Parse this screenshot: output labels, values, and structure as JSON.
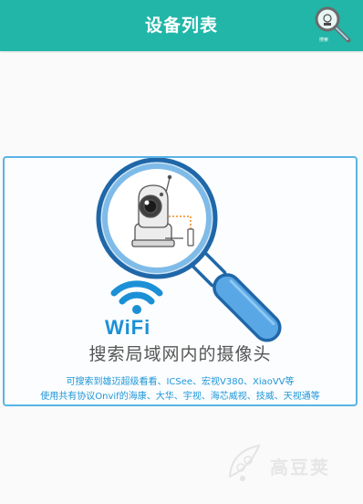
{
  "header": {
    "title": "设备列表",
    "search_caption": "搜索"
  },
  "card": {
    "wifi_label": "WiFi",
    "main_text": "搜索局域网内的摄像头",
    "sub_line1": "可搜索到雄迈超级看看、ICSee、宏视V380、XiaoVV等",
    "sub_line2": "使用共有协议Onvif的海康、大华、宇视、海芯威视、技威、天视通等"
  },
  "watermark": {
    "text": "高豆荚"
  },
  "colors": {
    "header_bg": "#21b6a8",
    "card_border": "#5ab4e6",
    "accent_blue": "#1e96d8",
    "wifi_blue": "#1c90d6"
  }
}
